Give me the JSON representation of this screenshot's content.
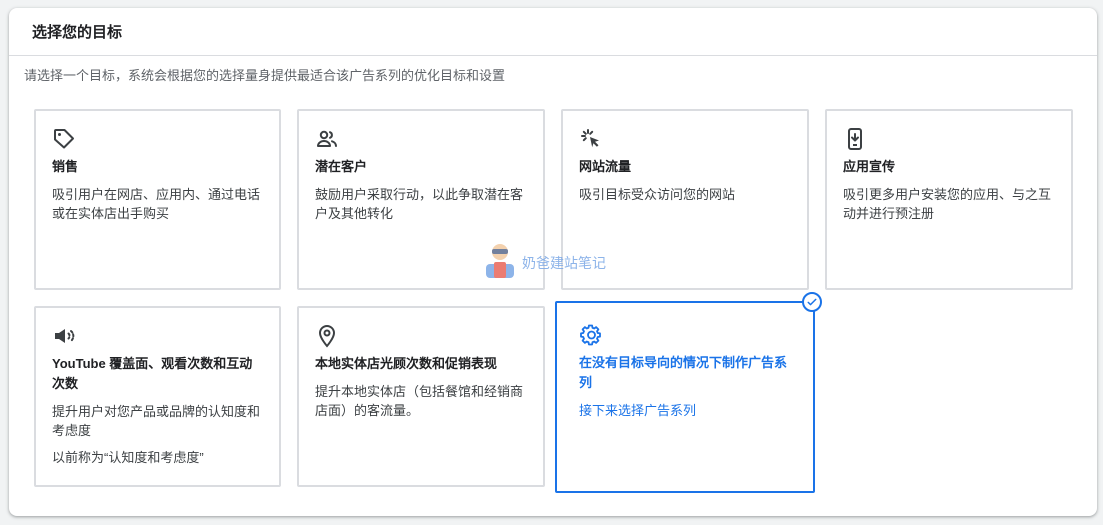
{
  "header": {
    "title": "选择您的目标"
  },
  "intro": "请选择一个目标，系统会根据您的选择量身提供最适合该广告系列的优化目标和设置",
  "cards": [
    {
      "title": "销售",
      "desc": "吸引用户在网店、应用内、通过电话或在实体店出手购买",
      "icon": "tag-icon"
    },
    {
      "title": "潜在客户",
      "desc": "鼓励用户采取行动，以此争取潜在客户及其他转化",
      "icon": "people-icon"
    },
    {
      "title": "网站流量",
      "desc": "吸引目标受众访问您的网站",
      "icon": "cursor-click-icon"
    },
    {
      "title": "应用宣传",
      "desc": "吸引更多用户安装您的应用、与之互动并进行预注册",
      "icon": "phone-download-icon"
    },
    {
      "title": "YouTube 覆盖面、观看次数和互动次数",
      "desc": "提升用户对您产品或品牌的认知度和考虑度",
      "note": "以前称为“认知度和考虑度”",
      "icon": "megaphone-icon"
    },
    {
      "title": "本地实体店光顾次数和促销表现",
      "desc": "提升本地实体店（包括餐馆和经销商店面）的客流量。",
      "icon": "location-pin-icon"
    },
    {
      "title": "在没有目标导向的情况下制作广告系列",
      "desc": "接下来选择广告系列",
      "icon": "gear-icon",
      "selected": true
    }
  ],
  "watermark": "奶爸建站笔记",
  "colors": {
    "accent": "#1a73e8",
    "border": "#dadce0",
    "icon": "#5f6368"
  }
}
